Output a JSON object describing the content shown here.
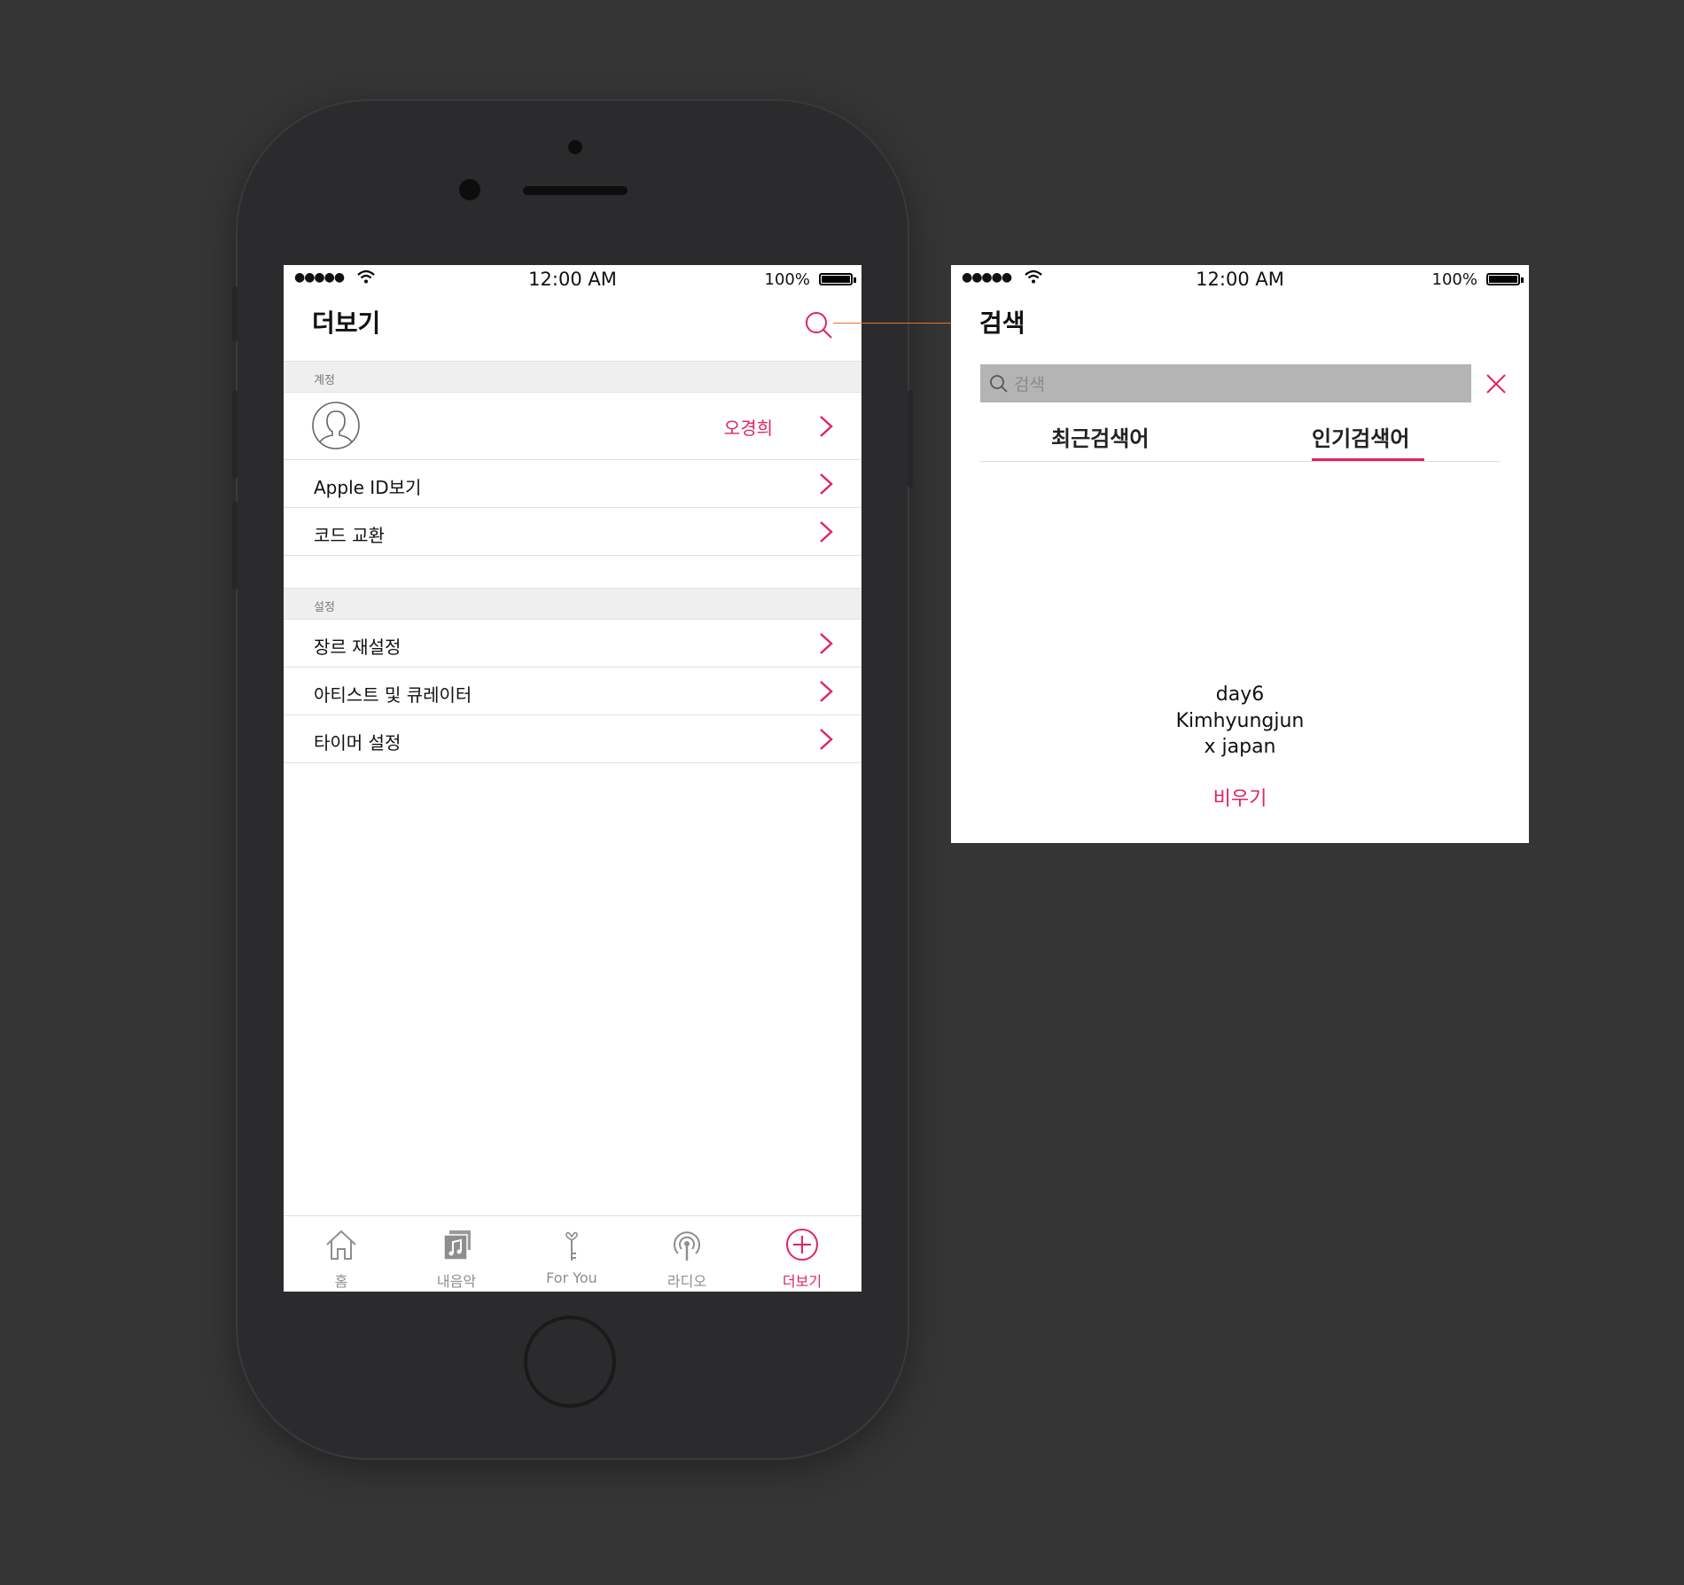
{
  "colors": {
    "accent": "#e0245e",
    "background": "#353535",
    "phone_body": "#2b2b2d",
    "callout": "#e8702a"
  },
  "status_bar": {
    "signal": "●●●●●",
    "time": "12:00 AM",
    "battery": "100%"
  },
  "main_screen": {
    "title": "더보기",
    "search_icon": "search-icon",
    "sections": [
      {
        "header": "계정",
        "rows": [
          {
            "type": "profile",
            "icon": "avatar-icon",
            "value": "오경희"
          },
          {
            "label": "Apple ID보기"
          },
          {
            "label": "코드 교환"
          }
        ]
      },
      {
        "header": "설정",
        "rows": [
          {
            "label": "장르 재설정"
          },
          {
            "label": "아티스트 및 큐레이터"
          },
          {
            "label": "타이머 설정"
          }
        ]
      }
    ],
    "tab_bar": [
      {
        "label": "홈",
        "icon": "home-icon",
        "active": false
      },
      {
        "label": "내음악",
        "icon": "music-album-icon",
        "active": false
      },
      {
        "label": "For You",
        "icon": "key-icon",
        "active": false
      },
      {
        "label": "라디오",
        "icon": "radio-icon",
        "active": false
      },
      {
        "label": "더보기",
        "icon": "plus-circle-icon",
        "active": true
      }
    ]
  },
  "search_screen": {
    "title": "검색",
    "placeholder": "검색",
    "tabs": [
      {
        "label": "최근검색어",
        "active": false
      },
      {
        "label": "인기검색어",
        "active": true
      }
    ],
    "results": [
      "day6",
      "Kimhyungjun",
      "x japan"
    ],
    "clear_label": "비우기"
  }
}
